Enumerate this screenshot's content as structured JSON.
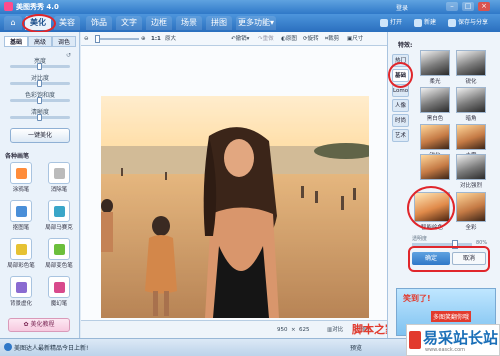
{
  "app": {
    "title": "美图秀秀 4.0",
    "user_link": "登录"
  },
  "menu": {
    "tabs": [
      {
        "label": "美化",
        "active": true
      },
      {
        "label": "美容"
      },
      {
        "label": "饰品"
      },
      {
        "label": "文字"
      },
      {
        "label": "边框"
      },
      {
        "label": "场景"
      },
      {
        "label": "拼图"
      },
      {
        "label": "更多功能"
      }
    ],
    "right": [
      {
        "label": "打开"
      },
      {
        "label": "新建"
      },
      {
        "label": "保存与分享"
      }
    ]
  },
  "left": {
    "subtabs": [
      "基础",
      "高级",
      "调色"
    ],
    "sliders": [
      {
        "label": "亮度",
        "value": 0.5
      },
      {
        "label": "对比度",
        "value": 0.5
      },
      {
        "label": "色彩饱和度",
        "value": 0.5
      },
      {
        "label": "清晰度",
        "value": 0.5
      }
    ],
    "one_key": "一键美化",
    "brushes_title": "各种画笔",
    "tools": [
      {
        "label": "涂鸦笔",
        "color": "#ff8c3a"
      },
      {
        "label": "消除笔",
        "color": "#bbbbbb"
      },
      {
        "label": "抠图笔",
        "color": "#4a8fd8"
      },
      {
        "label": "局部马赛克",
        "color": "#3aa6c8"
      },
      {
        "label": "局部彩色笔",
        "color": "#e6c233"
      },
      {
        "label": "局部变色笔",
        "color": "#6cbf3b"
      },
      {
        "label": "背景虚化",
        "color": "#8a6bd1"
      },
      {
        "label": "魔幻笔",
        "color": "#d84a8c"
      }
    ],
    "tutorial": "美化教程"
  },
  "toolbar": {
    "zoom_value": "1:1",
    "original": "原大",
    "items": [
      "撤销",
      "重做",
      "原图",
      "旋转",
      "裁剪",
      "尺寸"
    ]
  },
  "status": {
    "width": "950",
    "height": "625",
    "compare": "对比",
    "preview": "预览"
  },
  "right": {
    "title": "特效:",
    "categories": [
      "热门",
      "基础",
      "Lomo",
      "人像",
      "时尚",
      "艺术"
    ],
    "effects": [
      {
        "label": "柔光",
        "style": "bw"
      },
      {
        "label": "锐化",
        "style": "bw"
      },
      {
        "label": "黑白色",
        "style": "bw"
      },
      {
        "label": "暗角",
        "style": "bw"
      },
      {
        "label": "锐化",
        "style": "col"
      },
      {
        "label": "去雾",
        "style": "col"
      },
      {
        "label": "",
        "style": "col"
      },
      {
        "label": "对比强烈",
        "style": "bw"
      },
      {
        "label": "智能绘色",
        "style": "warm"
      },
      {
        "label": "全彩",
        "style": "col"
      }
    ],
    "opacity_label": "透明度",
    "opacity_percent": "80%",
    "ok": "确定",
    "cancel": "取消",
    "ad_line1": "笑到了!",
    "ad_line2": "多图笑翻你哦"
  },
  "bottom": {
    "notice": "美图达人最新精品今日上新!",
    "preview_link": "预览"
  },
  "watermark": {
    "text": "易采站长站",
    "url": "www.easck.com",
    "stamp": "脚本之家"
  },
  "colors": {
    "accent": "#2f78c8",
    "highlight_ring": "#e0262b"
  }
}
